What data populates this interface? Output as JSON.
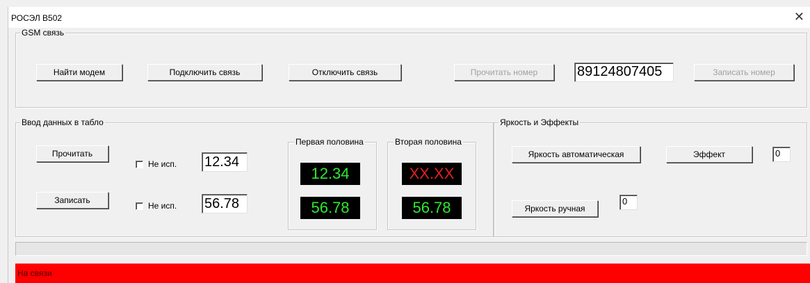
{
  "window": {
    "title": "РОСЭЛ В502",
    "close_icon": "close-icon"
  },
  "gsm": {
    "legend": "GSM связь",
    "find_modem_label": "Найти модем",
    "connect_label": "Подключить связь",
    "disconnect_label": "Отключить связь",
    "read_number_label": "Прочитать номер",
    "phone_number": "89124807405",
    "write_number_label": "Записать номер"
  },
  "input": {
    "legend": "Ввод данных в табло",
    "read_label": "Прочитать",
    "write_label": "Записать",
    "unused_label": "Не исп.",
    "unused1_checked": false,
    "unused2_checked": false,
    "value1": "12.34",
    "value2": "56.78"
  },
  "first_half": {
    "legend": "Первая половина",
    "top": "12.34",
    "bottom": "56.78"
  },
  "second_half": {
    "legend": "Вторая половина",
    "top": "XX.XX",
    "bottom": "56.78"
  },
  "brightness": {
    "legend": "Яркость и Эффекты",
    "auto_label": "Яркость автоматическая",
    "effect_label": "Эффект",
    "effect_value": "0",
    "manual_label": "Яркость ручная",
    "manual_value": "0"
  },
  "progress": {
    "value": 0
  },
  "status": {
    "text": "На связи"
  },
  "colors": {
    "status_bg": "#ff0000",
    "display_green": "#2ee82e",
    "display_red": "#e02020",
    "display_bg": "#000000"
  }
}
